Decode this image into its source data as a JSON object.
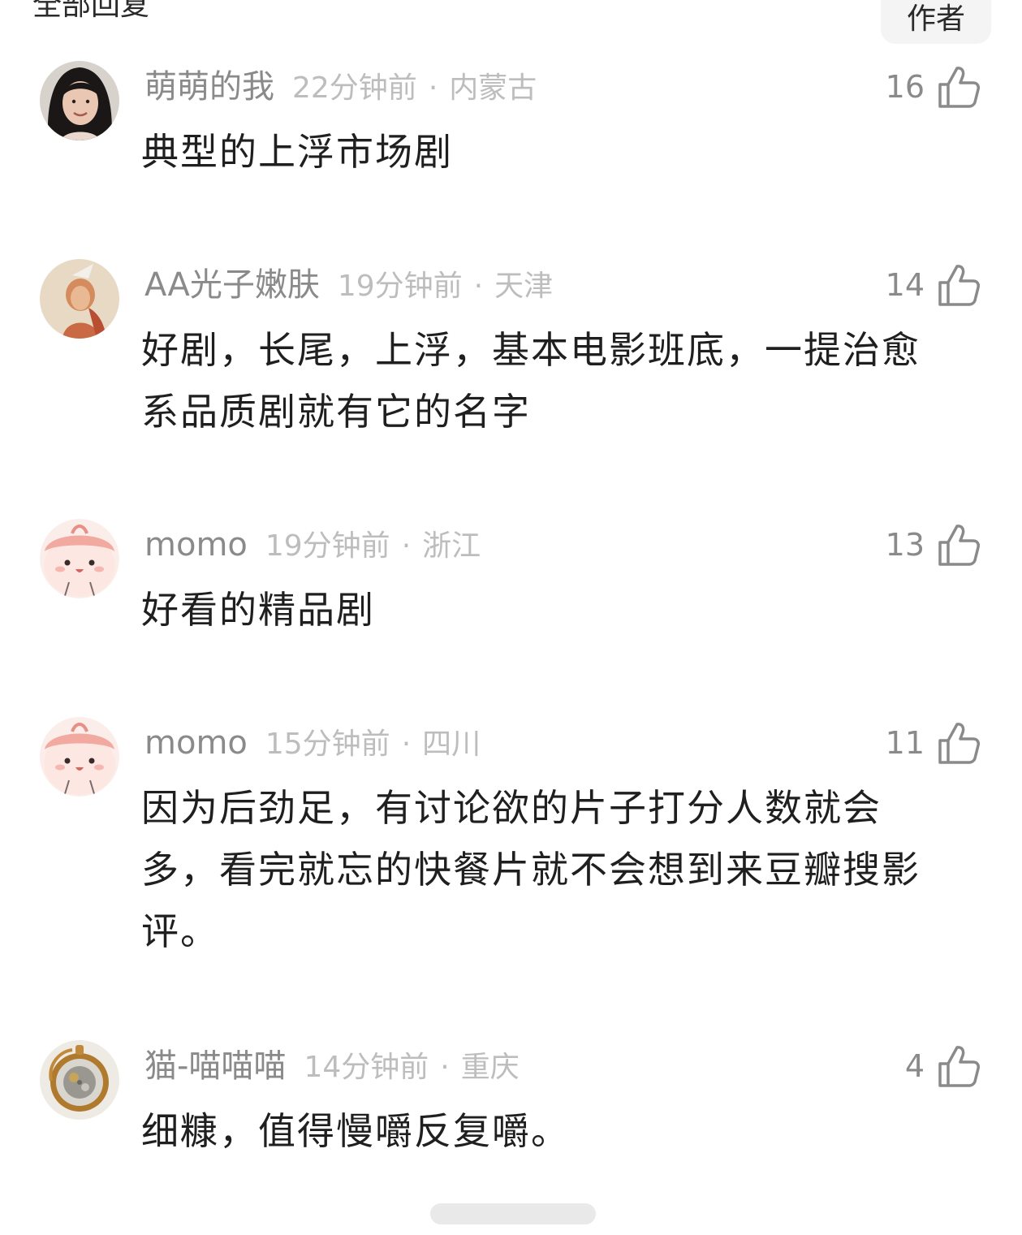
{
  "header": {
    "title": "全部回复",
    "author_button": "作者"
  },
  "comments": [
    {
      "username": "萌萌的我",
      "time": "22分钟前",
      "separator": "·",
      "location": "内蒙古",
      "likes": "16",
      "text": "典型的上浮市场剧",
      "avatar_icon": "avatar-woman-photo"
    },
    {
      "username": "AA光子嫩肤",
      "time": "19分钟前",
      "separator": "·",
      "location": "天津",
      "likes": "14",
      "text": "好剧，长尾，上浮，基本电影班底，一提治愈系品质剧就有它的名字",
      "avatar_icon": "avatar-portrait-photo"
    },
    {
      "username": "momo",
      "time": "19分钟前",
      "separator": "·",
      "location": "浙江",
      "likes": "13",
      "text": "好看的精品剧",
      "avatar_icon": "avatar-pink-cartoon"
    },
    {
      "username": "momo",
      "time": "15分钟前",
      "separator": "·",
      "location": "四川",
      "likes": "11",
      "text": "因为后劲足，有讨论欲的片子打分人数就会多，看完就忘的快餐片就不会想到来豆瓣搜影评。",
      "avatar_icon": "avatar-pink-cartoon"
    },
    {
      "username": "猫-喵喵喵",
      "time": "14分钟前",
      "separator": "·",
      "location": "重庆",
      "likes": "4",
      "text": "细糠，值得慢嚼反复嚼。",
      "avatar_icon": "avatar-pocket-watch"
    }
  ],
  "colors": {
    "username": "#8a8a8a",
    "meta": "#bdbdbd",
    "text": "#1f1f1f",
    "button_bg": "#f4f4f4"
  }
}
